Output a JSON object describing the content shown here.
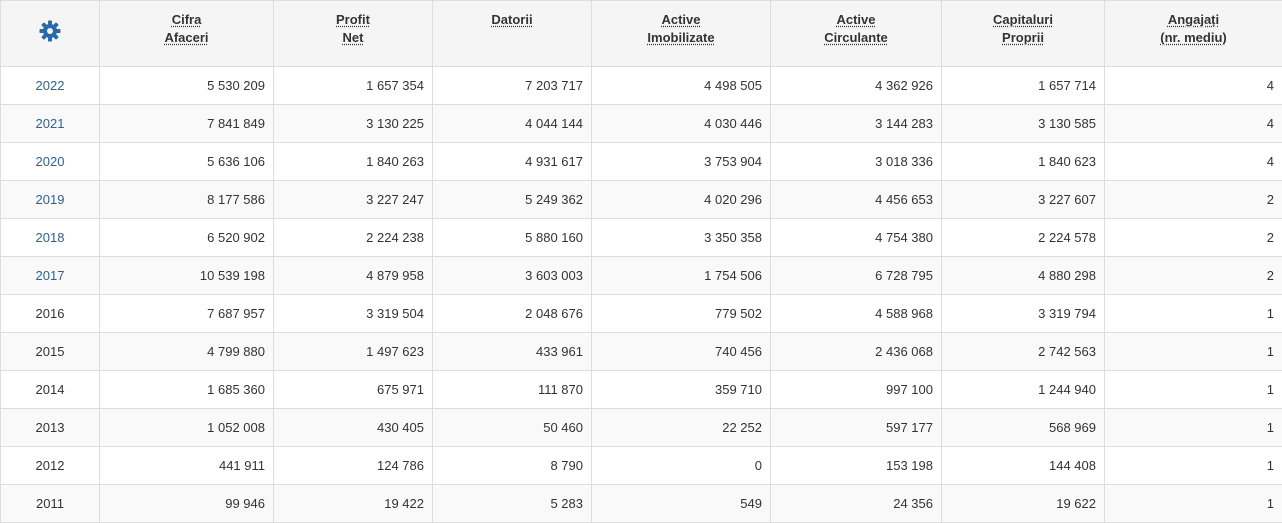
{
  "accent": "#2a6496",
  "header": {
    "settings_icon": "gear-icon",
    "columns": [
      {
        "line1": "Cifra",
        "line2": "Afaceri"
      },
      {
        "line1": "Profit",
        "line2": "Net"
      },
      {
        "line1": "Datorii",
        "line2": ""
      },
      {
        "line1": "Active",
        "line2": "Imobilizate"
      },
      {
        "line1": "Active",
        "line2": "Circulante"
      },
      {
        "line1": "Capitaluri",
        "line2": "Proprii"
      },
      {
        "line1": "Angajați",
        "line2": "(nr. mediu)"
      }
    ]
  },
  "rows": [
    {
      "year": "2022",
      "link": true,
      "values": [
        "5 530 209",
        "1 657 354",
        "7 203 717",
        "4 498 505",
        "4 362 926",
        "1 657 714",
        "4"
      ]
    },
    {
      "year": "2021",
      "link": true,
      "values": [
        "7 841 849",
        "3 130 225",
        "4 044 144",
        "4 030 446",
        "3 144 283",
        "3 130 585",
        "4"
      ]
    },
    {
      "year": "2020",
      "link": true,
      "values": [
        "5 636 106",
        "1 840 263",
        "4 931 617",
        "3 753 904",
        "3 018 336",
        "1 840 623",
        "4"
      ]
    },
    {
      "year": "2019",
      "link": true,
      "values": [
        "8 177 586",
        "3 227 247",
        "5 249 362",
        "4 020 296",
        "4 456 653",
        "3 227 607",
        "2"
      ]
    },
    {
      "year": "2018",
      "link": true,
      "values": [
        "6 520 902",
        "2 224 238",
        "5 880 160",
        "3 350 358",
        "4 754 380",
        "2 224 578",
        "2"
      ]
    },
    {
      "year": "2017",
      "link": true,
      "values": [
        "10 539 198",
        "4 879 958",
        "3 603 003",
        "1 754 506",
        "6 728 795",
        "4 880 298",
        "2"
      ]
    },
    {
      "year": "2016",
      "link": false,
      "values": [
        "7 687 957",
        "3 319 504",
        "2 048 676",
        "779 502",
        "4 588 968",
        "3 319 794",
        "1"
      ]
    },
    {
      "year": "2015",
      "link": false,
      "values": [
        "4 799 880",
        "1 497 623",
        "433 961",
        "740 456",
        "2 436 068",
        "2 742 563",
        "1"
      ]
    },
    {
      "year": "2014",
      "link": false,
      "values": [
        "1 685 360",
        "675 971",
        "111 870",
        "359 710",
        "997 100",
        "1 244 940",
        "1"
      ]
    },
    {
      "year": "2013",
      "link": false,
      "values": [
        "1 052 008",
        "430 405",
        "50 460",
        "22 252",
        "597 177",
        "568 969",
        "1"
      ]
    },
    {
      "year": "2012",
      "link": false,
      "values": [
        "441 911",
        "124 786",
        "8 790",
        "0",
        "153 198",
        "144 408",
        "1"
      ]
    },
    {
      "year": "2011",
      "link": false,
      "values": [
        "99 946",
        "19 422",
        "5 283",
        "549",
        "24 356",
        "19 622",
        "1"
      ]
    }
  ]
}
